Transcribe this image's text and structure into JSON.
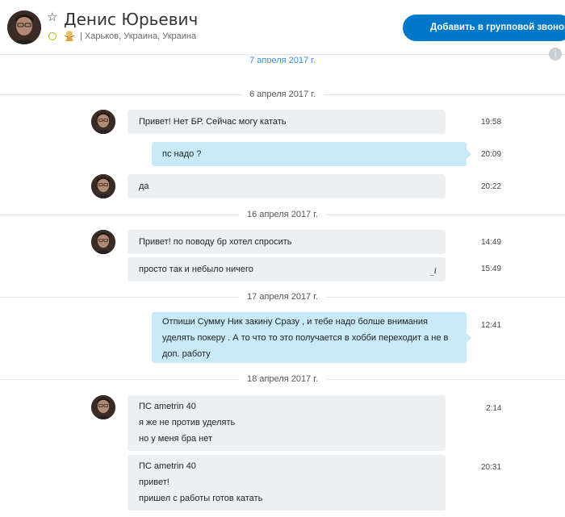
{
  "header": {
    "contact_name": "Денис Юрьевич",
    "location": "| Харьков, Украина, Украина",
    "group_call_label": "Добавить в групповой звонок",
    "star_icon": "star-outline-icon",
    "presence_icon": "presence-away-icon",
    "mood_icon": "mood-emoticon-icon"
  },
  "scroll_hint": "7 апреля 2017 г.",
  "info_icon": "i",
  "dates": [
    "6 апреля 2017 г.",
    "16 апреля 2017 г.",
    "17 апреля 2017 г.",
    "18 апреля 2017 г."
  ],
  "messages": [
    {
      "lines": [
        "Привет! Нет БР. Сейчас могу катать"
      ],
      "time": "19:58",
      "direction": "incoming"
    },
    {
      "lines": [
        "пс надо ?"
      ],
      "time": "20:09",
      "direction": "outgoing"
    },
    {
      "lines": [
        "да"
      ],
      "time": "20:22",
      "direction": "incoming"
    },
    {
      "lines": [
        "Привет! по поводу бр хотел спросить"
      ],
      "time": "14:49",
      "direction": "incoming"
    },
    {
      "lines": [
        "просто так и небыло ничего"
      ],
      "time": "15:49",
      "direction": "incoming",
      "edited_mark": "_i"
    },
    {
      "lines": [
        "Отпиши Сумму Ник закину Сразу , и тебе надо болше внимания",
        "уделять покеру . А то что то это получается в хобби переходит а не в",
        "доп. работу"
      ],
      "time": "12:41",
      "direction": "outgoing"
    },
    {
      "lines": [
        "ПС ametrin 40",
        "я же не против уделять",
        "но у меня бра нет"
      ],
      "time": "2:14",
      "direction": "incoming"
    },
    {
      "lines": [
        "ПС ametrin 40",
        "привет!",
        "пришел с работы готов катать"
      ],
      "time": "20:31",
      "direction": "incoming"
    }
  ],
  "colors": {
    "accent": "#0078ca",
    "incoming_bubble": "#edf0f3",
    "outgoing_bubble": "#c7e9f8"
  }
}
